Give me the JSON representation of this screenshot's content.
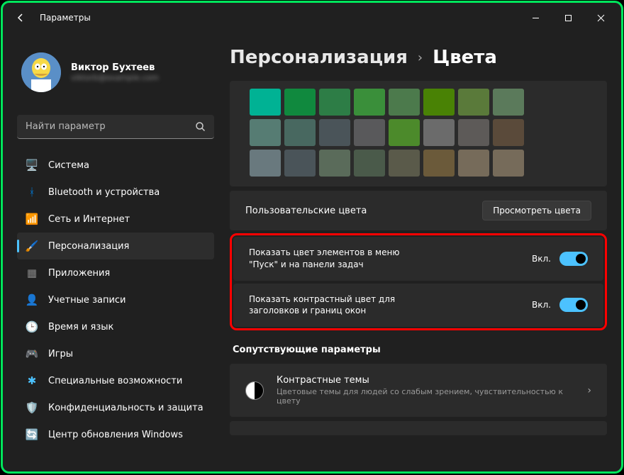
{
  "window": {
    "title": "Параметры"
  },
  "user": {
    "name": "Виктор Бухтеев",
    "email": "viktorb@example.com"
  },
  "search": {
    "placeholder": "Найти параметр"
  },
  "nav": [
    {
      "id": "system",
      "label": "Система",
      "icon": "🖥️",
      "color": "#0078d4"
    },
    {
      "id": "bluetooth",
      "label": "Bluetooth и устройства",
      "icon": "ᚼ",
      "color": "#0078d4"
    },
    {
      "id": "network",
      "label": "Сеть и Интернет",
      "icon": "📶",
      "color": "#1fb6c1"
    },
    {
      "id": "personalization",
      "label": "Персонализация",
      "icon": "🖌️",
      "color": "#c04b8a",
      "active": true
    },
    {
      "id": "apps",
      "label": "Приложения",
      "icon": "▦",
      "color": "#888"
    },
    {
      "id": "accounts",
      "label": "Учетные записи",
      "icon": "👤",
      "color": "#e08a3c"
    },
    {
      "id": "time",
      "label": "Время и язык",
      "icon": "🕒",
      "color": "#7a98e8"
    },
    {
      "id": "games",
      "label": "Игры",
      "icon": "🎮",
      "color": "#888"
    },
    {
      "id": "accessibility",
      "label": "Специальные возможности",
      "icon": "✱",
      "color": "#4cc2ff"
    },
    {
      "id": "privacy",
      "label": "Конфиденциальность и защита",
      "icon": "🛡️",
      "color": "#888"
    },
    {
      "id": "update",
      "label": "Центр обновления Windows",
      "icon": "🔄",
      "color": "#e08a3c"
    }
  ],
  "breadcrumb": {
    "parent": "Персонализация",
    "current": "Цвета"
  },
  "swatches": [
    [
      "#00b294",
      "#10893e",
      "#2d7d46",
      "#3a8f3a",
      "#4c7a4c",
      "#498205",
      "#5a7a3a",
      "#5b7a5b"
    ],
    [
      "#567c73",
      "#486860",
      "#4a5459",
      "#59595b",
      "#4c8a2b",
      "#6b6b6b",
      "#5d5a58",
      "#5a4a3a"
    ],
    [
      "#69797e",
      "#4a5459",
      "#5a6b5a",
      "#4a5a4a",
      "#5a5a4a",
      "#6b5a3a",
      "#766b5a",
      "#766b5a"
    ]
  ],
  "customColors": {
    "label": "Пользовательские цвета",
    "button": "Просмотреть цвета"
  },
  "toggles": [
    {
      "label": "Показать цвет элементов в меню \"Пуск\" и на панели задач",
      "state": "Вкл."
    },
    {
      "label": "Показать контрастный цвет для заголовков и границ окон",
      "state": "Вкл."
    }
  ],
  "related": {
    "heading": "Сопутствующие параметры",
    "item": {
      "title": "Контрастные темы",
      "sub": "Цветовые темы для людей со слабым зрением, чувствительностью к цвету"
    }
  }
}
